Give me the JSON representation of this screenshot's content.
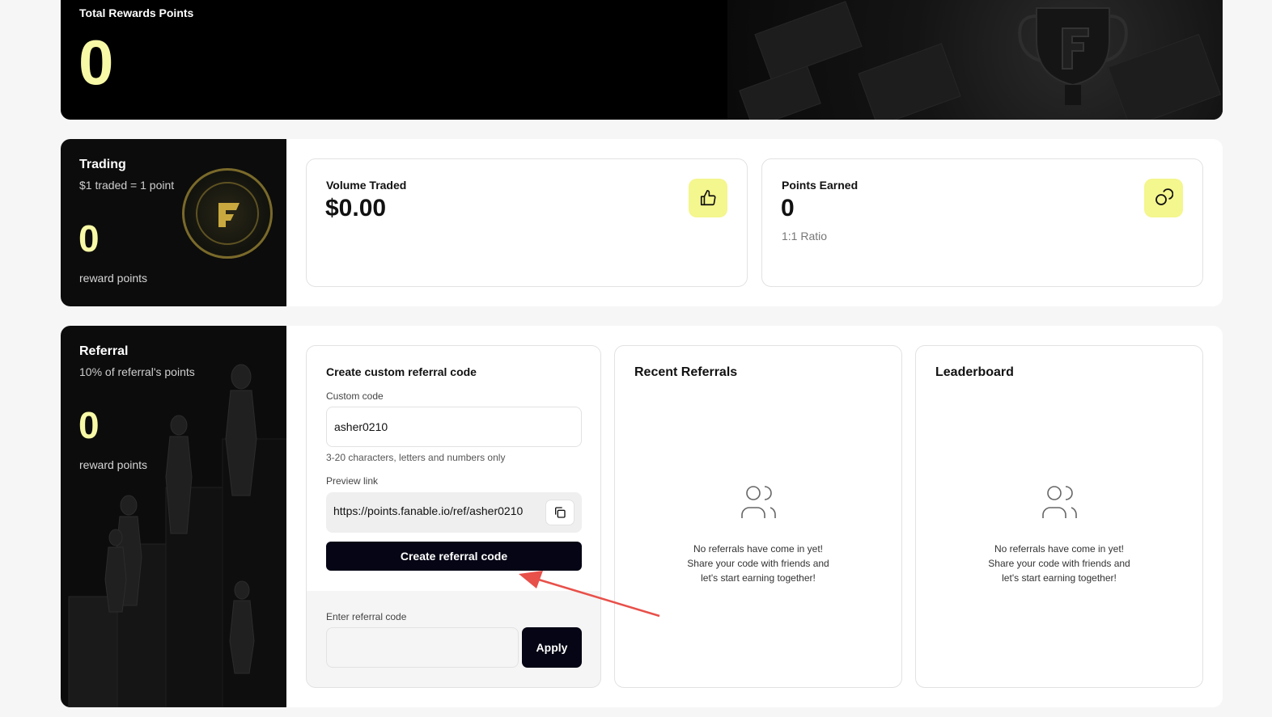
{
  "hero": {
    "title": "Total Rewards Points",
    "value": "0"
  },
  "trading": {
    "title": "Trading",
    "subtitle": "$1 traded = 1 point",
    "value": "0",
    "value_label": "reward points",
    "cards": [
      {
        "label": "Volume Traded",
        "value": "$0.00",
        "icon": "thumbs-up-icon"
      },
      {
        "label": "Points Earned",
        "value": "0",
        "note": "1:1 Ratio",
        "icon": "coins-icon"
      }
    ]
  },
  "referral": {
    "title": "Referral",
    "subtitle": "10% of referral's points",
    "value": "0",
    "value_label": "reward points",
    "form": {
      "title": "Create custom referral code",
      "custom_code_label": "Custom code",
      "custom_code_value": "asher0210",
      "hint": "3-20 characters, letters and numbers only",
      "preview_label": "Preview link",
      "preview_link": "https://points.fanable.io/ref/asher0210",
      "create_button": "Create referral code",
      "enter_label": "Enter referral code",
      "enter_value": "",
      "apply_button": "Apply"
    },
    "recent": {
      "title": "Recent Referrals",
      "empty_lines": [
        "No referrals have come in yet!",
        "Share your code with friends and",
        "let's start earning together!"
      ]
    },
    "leaderboard": {
      "title": "Leaderboard",
      "empty_lines": [
        "No referrals have come in yet!",
        "Share your code with friends and",
        "let's start earning together!"
      ]
    }
  },
  "colors": {
    "accent": "#f8f9a6",
    "chip": "#f4f68e",
    "button": "#050515",
    "annotation": "#e8504a"
  }
}
